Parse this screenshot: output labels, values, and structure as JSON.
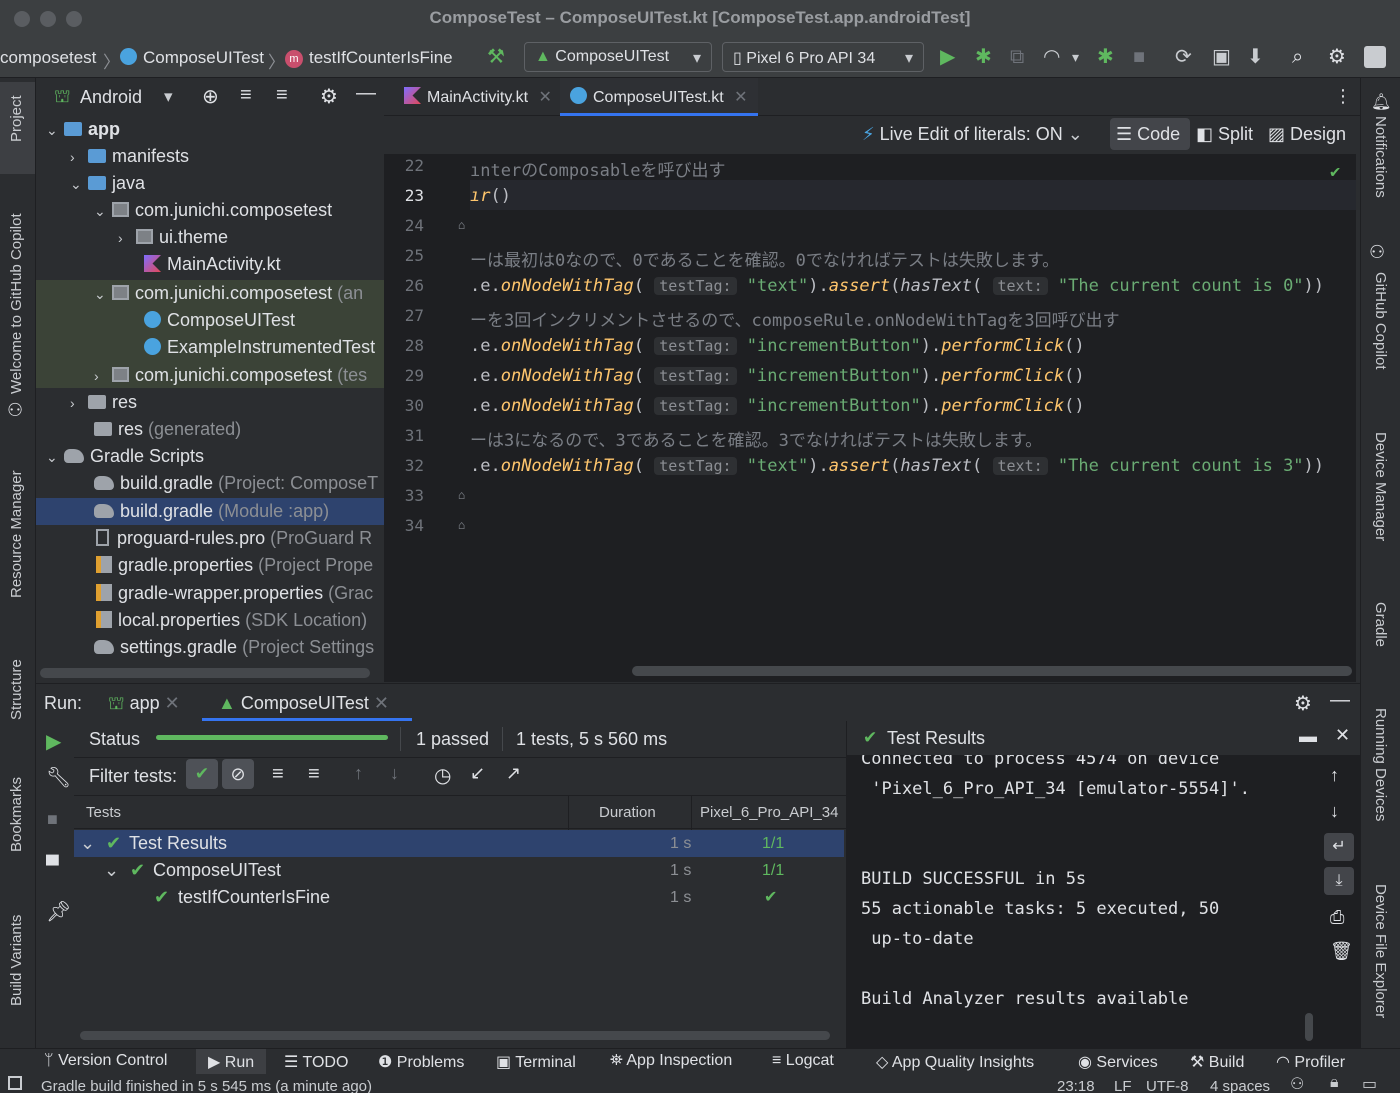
{
  "window": {
    "title": "ComposeTest – ComposeUITest.kt [ComposeTest.app.androidTest]"
  },
  "toolbar": {
    "breadcrumb": [
      "composetest",
      "ComposeUITest",
      "testIfCounterIsFine"
    ],
    "run_config": "ComposeUITest",
    "device": "Pixel 6 Pro API 34"
  },
  "left_strip": {
    "tabs": [
      "Project",
      "Welcome to GitHub Copilot",
      "Resource Manager",
      "Structure",
      "Bookmarks",
      "Build Variants"
    ]
  },
  "right_strip": {
    "tabs": [
      "Notifications",
      "GitHub Copilot",
      "Device Manager",
      "Gradle",
      "Running Devices",
      "Device File Explorer"
    ]
  },
  "project": {
    "view": "Android",
    "tree": [
      {
        "label": "app",
        "suffix": ""
      },
      {
        "label": "manifests",
        "suffix": ""
      },
      {
        "label": "java",
        "suffix": ""
      },
      {
        "label": "com.junichi.composetest",
        "suffix": ""
      },
      {
        "label": "ui.theme",
        "suffix": ""
      },
      {
        "label": "MainActivity.kt",
        "suffix": ""
      },
      {
        "label": "com.junichi.composetest",
        "suffix": "(an"
      },
      {
        "label": "ComposeUITest",
        "suffix": ""
      },
      {
        "label": "ExampleInstrumentedTest",
        "suffix": ""
      },
      {
        "label": "com.junichi.composetest",
        "suffix": "(tes"
      },
      {
        "label": "res",
        "suffix": ""
      },
      {
        "label": "res",
        "suffix": "(generated)"
      },
      {
        "label": "Gradle Scripts",
        "suffix": ""
      },
      {
        "label": "build.gradle",
        "suffix": "(Project: ComposeT"
      },
      {
        "label": "build.gradle",
        "suffix": "(Module :app)"
      },
      {
        "label": "proguard-rules.pro",
        "suffix": "(ProGuard R"
      },
      {
        "label": "gradle.properties",
        "suffix": "(Project Prope"
      },
      {
        "label": "gradle-wrapper.properties",
        "suffix": "(Grac"
      },
      {
        "label": "local.properties",
        "suffix": "(SDK Location)"
      },
      {
        "label": "settings.gradle",
        "suffix": "(Project Settings"
      }
    ]
  },
  "editor": {
    "tabs": [
      "MainActivity.kt",
      "ComposeUITest.kt"
    ],
    "live_edit": "Live Edit of literals: ON",
    "modes": [
      "Code",
      "Split",
      "Design"
    ],
    "line_numbers": [
      "22",
      "23",
      "24",
      "25",
      "26",
      "27",
      "28",
      "29",
      "30",
      "31",
      "32",
      "33",
      "34"
    ],
    "lines": {
      "l22": "ınterのComposableを呼び出す",
      "l23a": "ır",
      "l23b": "()",
      "l25": "ーは最初は0なので、0であることを確認。0でなければテストは失敗します。",
      "l27": "ーを3回インクリメントさせるので、composeRule.onNodeWithTagを3回呼び出す",
      "l31": "ーは3になるので、3であることを確認。3でなければテストは失敗します。",
      "prefix": ".e.",
      "onNodeWithTag": "onNodeWithTag",
      "paren_open": "( ",
      "testTag_hint": "testTag:",
      "text_hint": "text:",
      "assert": "assert",
      "hasText": "hasText",
      "performClick": "performClick",
      "str_text": "\"text\"",
      "str_increment": "\"incrementButton\"",
      "str_count0": "\"The current count is 0\"",
      "str_count3": "\"The current count is 3\"",
      "close_paren": ")",
      "dot": ".",
      "open_paren": "(",
      "empty_call": "()",
      "double_close": "))"
    }
  },
  "run": {
    "label": "Run:",
    "tabs": [
      "app",
      "ComposeUITest"
    ],
    "status_label": "Status",
    "passed": "1 passed",
    "summary": "1 tests, 5 s 560 ms",
    "filter_label": "Filter tests:",
    "columns": [
      "Tests",
      "Duration",
      "Pixel_6_Pro_API_34"
    ],
    "rows": [
      {
        "name": "Test Results",
        "duration": "1 s",
        "result": "1/1"
      },
      {
        "name": "ComposeUITest",
        "duration": "1 s",
        "result": "1/1"
      },
      {
        "name": "testIfCounterIsFine",
        "duration": "1 s",
        "result": "✔"
      }
    ],
    "progress": 1.0
  },
  "console": {
    "title": "Test Results",
    "lines": [
      "Connected to process 4574 on device",
      " 'Pixel_6_Pro_API_34 [emulator-5554]'.",
      "",
      "",
      "BUILD SUCCESSFUL in 5s",
      "55 actionable tasks: 5 executed, 50",
      " up-to-date",
      "",
      "Build Analyzer results available"
    ]
  },
  "toolwindows": [
    "Version Control",
    "Run",
    "TODO",
    "Problems",
    "Terminal",
    "App Inspection",
    "Logcat",
    "App Quality Insights",
    "Services",
    "Build",
    "Profiler"
  ],
  "status": {
    "message": "Gradle build finished in 5 s 545 ms (a minute ago)",
    "position": "23:18",
    "line_sep": "LF",
    "encoding": "UTF-8",
    "indent": "4 spaces"
  },
  "colors": {
    "accent": "#3574f0",
    "success": "#5fb85f",
    "string": "#6aab73",
    "function": "#ffc66d"
  }
}
